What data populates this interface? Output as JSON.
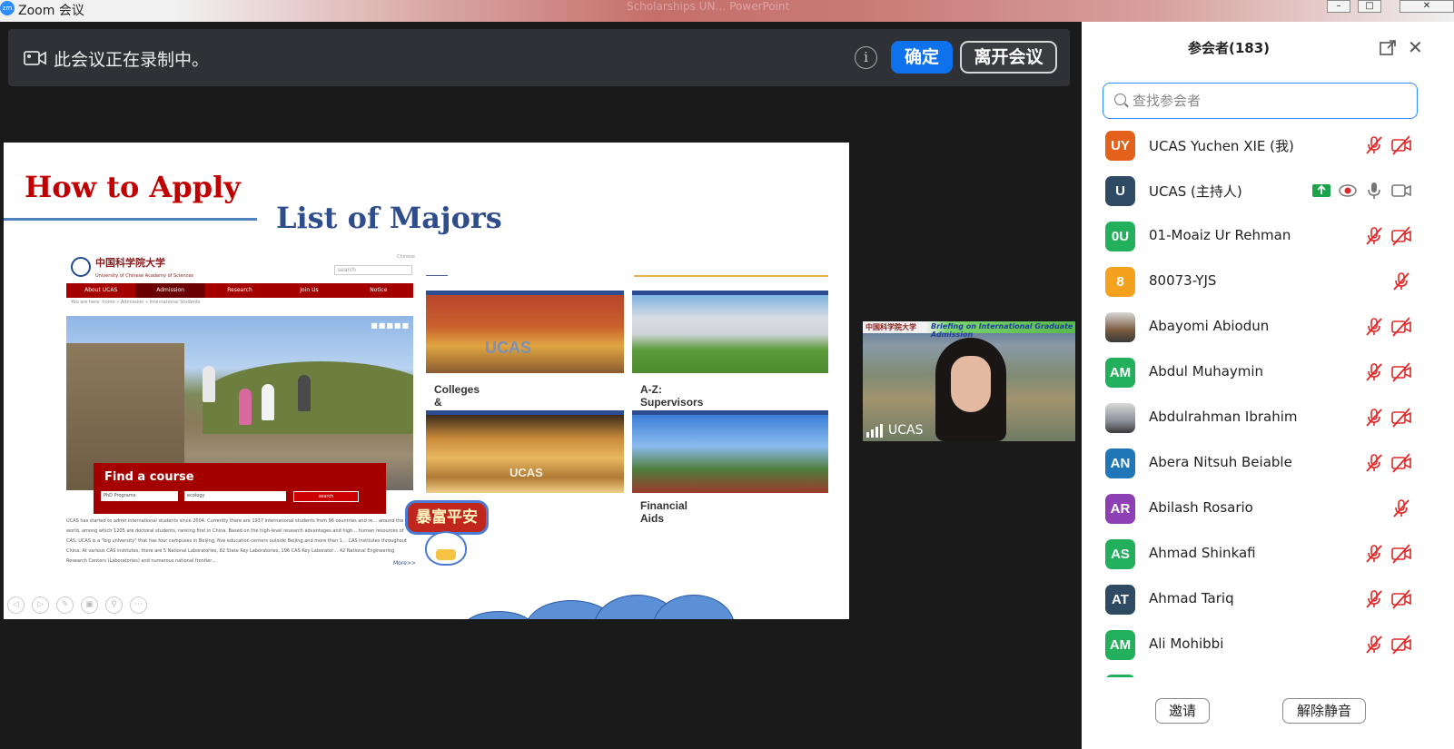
{
  "window": {
    "app_logo": "zm",
    "title": "Zoom 会议",
    "ghost_title": "Scholarships UN… PowerPoint",
    "minimize_icon": "minimize-icon",
    "maximize_icon": "maximize-icon",
    "close_icon": "close-icon"
  },
  "banner": {
    "text": "此会议正在录制中。",
    "info_symbol": "i",
    "ok_label": "确定",
    "leave_label": "离开会议"
  },
  "slide": {
    "title": "How to Apply",
    "subtitle": "List of Majors",
    "website": {
      "logo_text": "中国科学院大学",
      "logo_sub": "University of Chinese Academy of Sciences",
      "search_placeholder": "search",
      "lang": "Chinese",
      "nav": [
        "About UCAS",
        "Admission",
        "Research",
        "Join Us",
        "Notice"
      ],
      "active_nav": "Admission",
      "breadcrumb": "You are here:  home  »  Admission  »  International Students",
      "find_title": "Find a course",
      "find_select": "PhD Programs",
      "find_input": "ecology",
      "find_button": "search",
      "paragraph": "UCAS has started to admit international students since 2004. Currently there are 1937 international students from 96 countries and re… around the world, among which 1205 are doctoral students, ranking first in China. Based on the high-level research advantages and high… human resources of CAS, UCAS is a \"big university\" that has four campuses in Beijing, five education centers outside Beijing and more than 1… CAS institutes throughout China. At various CAS institutes, there are 5 National Laboratories, 82 State Key Laboratories, 196 CAS Key Laborator… 42 National Engineering Research Centers (Laboratories) and numerous national frontier…",
      "more": "More>>"
    },
    "cards": [
      {
        "caption": "Colleges & Institutes",
        "img_word": "UCAS"
      },
      {
        "caption": "A-Z: Supervisors",
        "img_word": ""
      },
      {
        "caption": "",
        "img_word": "UCAS"
      },
      {
        "caption": "Financial Aids",
        "img_word": ""
      }
    ],
    "badge_text": "暴富平安",
    "controls": [
      "◁",
      "▷",
      "✎",
      "▣",
      "⚲",
      "⋯"
    ]
  },
  "video": {
    "logo_text": "中国科学院大学",
    "banner_title": "Briefing on International Graduate Admission",
    "name": "UCAS"
  },
  "panel": {
    "title": "参会者(183)",
    "search_placeholder": "查找参会者",
    "invite_label": "邀请",
    "unmute_label": "解除静音",
    "participants": [
      {
        "initials": "UY",
        "name": "UCAS Yuchen XIE (我)",
        "color": "#e4611c",
        "mic": "muted",
        "video": "off"
      },
      {
        "initials": "U",
        "name": "UCAS (主持人)",
        "color": "#2f4a63",
        "mic": "on",
        "video": "on",
        "host": true
      },
      {
        "initials": "0U",
        "name": "01-Moaiz Ur Rehman",
        "color": "#23b05c",
        "mic": "muted",
        "video": "off"
      },
      {
        "initials": "8",
        "name": "80073-YJS",
        "color": "#f4a11d",
        "mic": "muted",
        "video": "none"
      },
      {
        "initials": "",
        "name": "Abayomi Abiodun",
        "color": "#7a5a3e",
        "mic": "muted",
        "video": "off",
        "photo": true
      },
      {
        "initials": "AM",
        "name": "Abdul Muhaymin",
        "color": "#23b05c",
        "mic": "muted",
        "video": "off"
      },
      {
        "initials": "",
        "name": "Abdulrahman Ibrahim",
        "color": "#8a8f98",
        "mic": "muted",
        "video": "off",
        "photo": true
      },
      {
        "initials": "AN",
        "name": "Abera Nitsuh Beiable",
        "color": "#1f77b8",
        "mic": "muted",
        "video": "off"
      },
      {
        "initials": "AR",
        "name": "Abilash Rosario",
        "color": "#8e3fb3",
        "mic": "muted",
        "video": "none"
      },
      {
        "initials": "AS",
        "name": "Ahmad Shinkafi",
        "color": "#23b05c",
        "mic": "muted",
        "video": "off"
      },
      {
        "initials": "AT",
        "name": "Ahmad Tariq",
        "color": "#2f4a63",
        "mic": "muted",
        "video": "off"
      },
      {
        "initials": "AM",
        "name": "Ali Mohibbi",
        "color": "#23b05c",
        "mic": "muted",
        "video": "off"
      }
    ]
  },
  "colors": {
    "accent": "#0e72ed",
    "muted_red": "#e02828",
    "slide_title_red": "#c00000",
    "slide_sub_blue": "#2e4d8a"
  }
}
